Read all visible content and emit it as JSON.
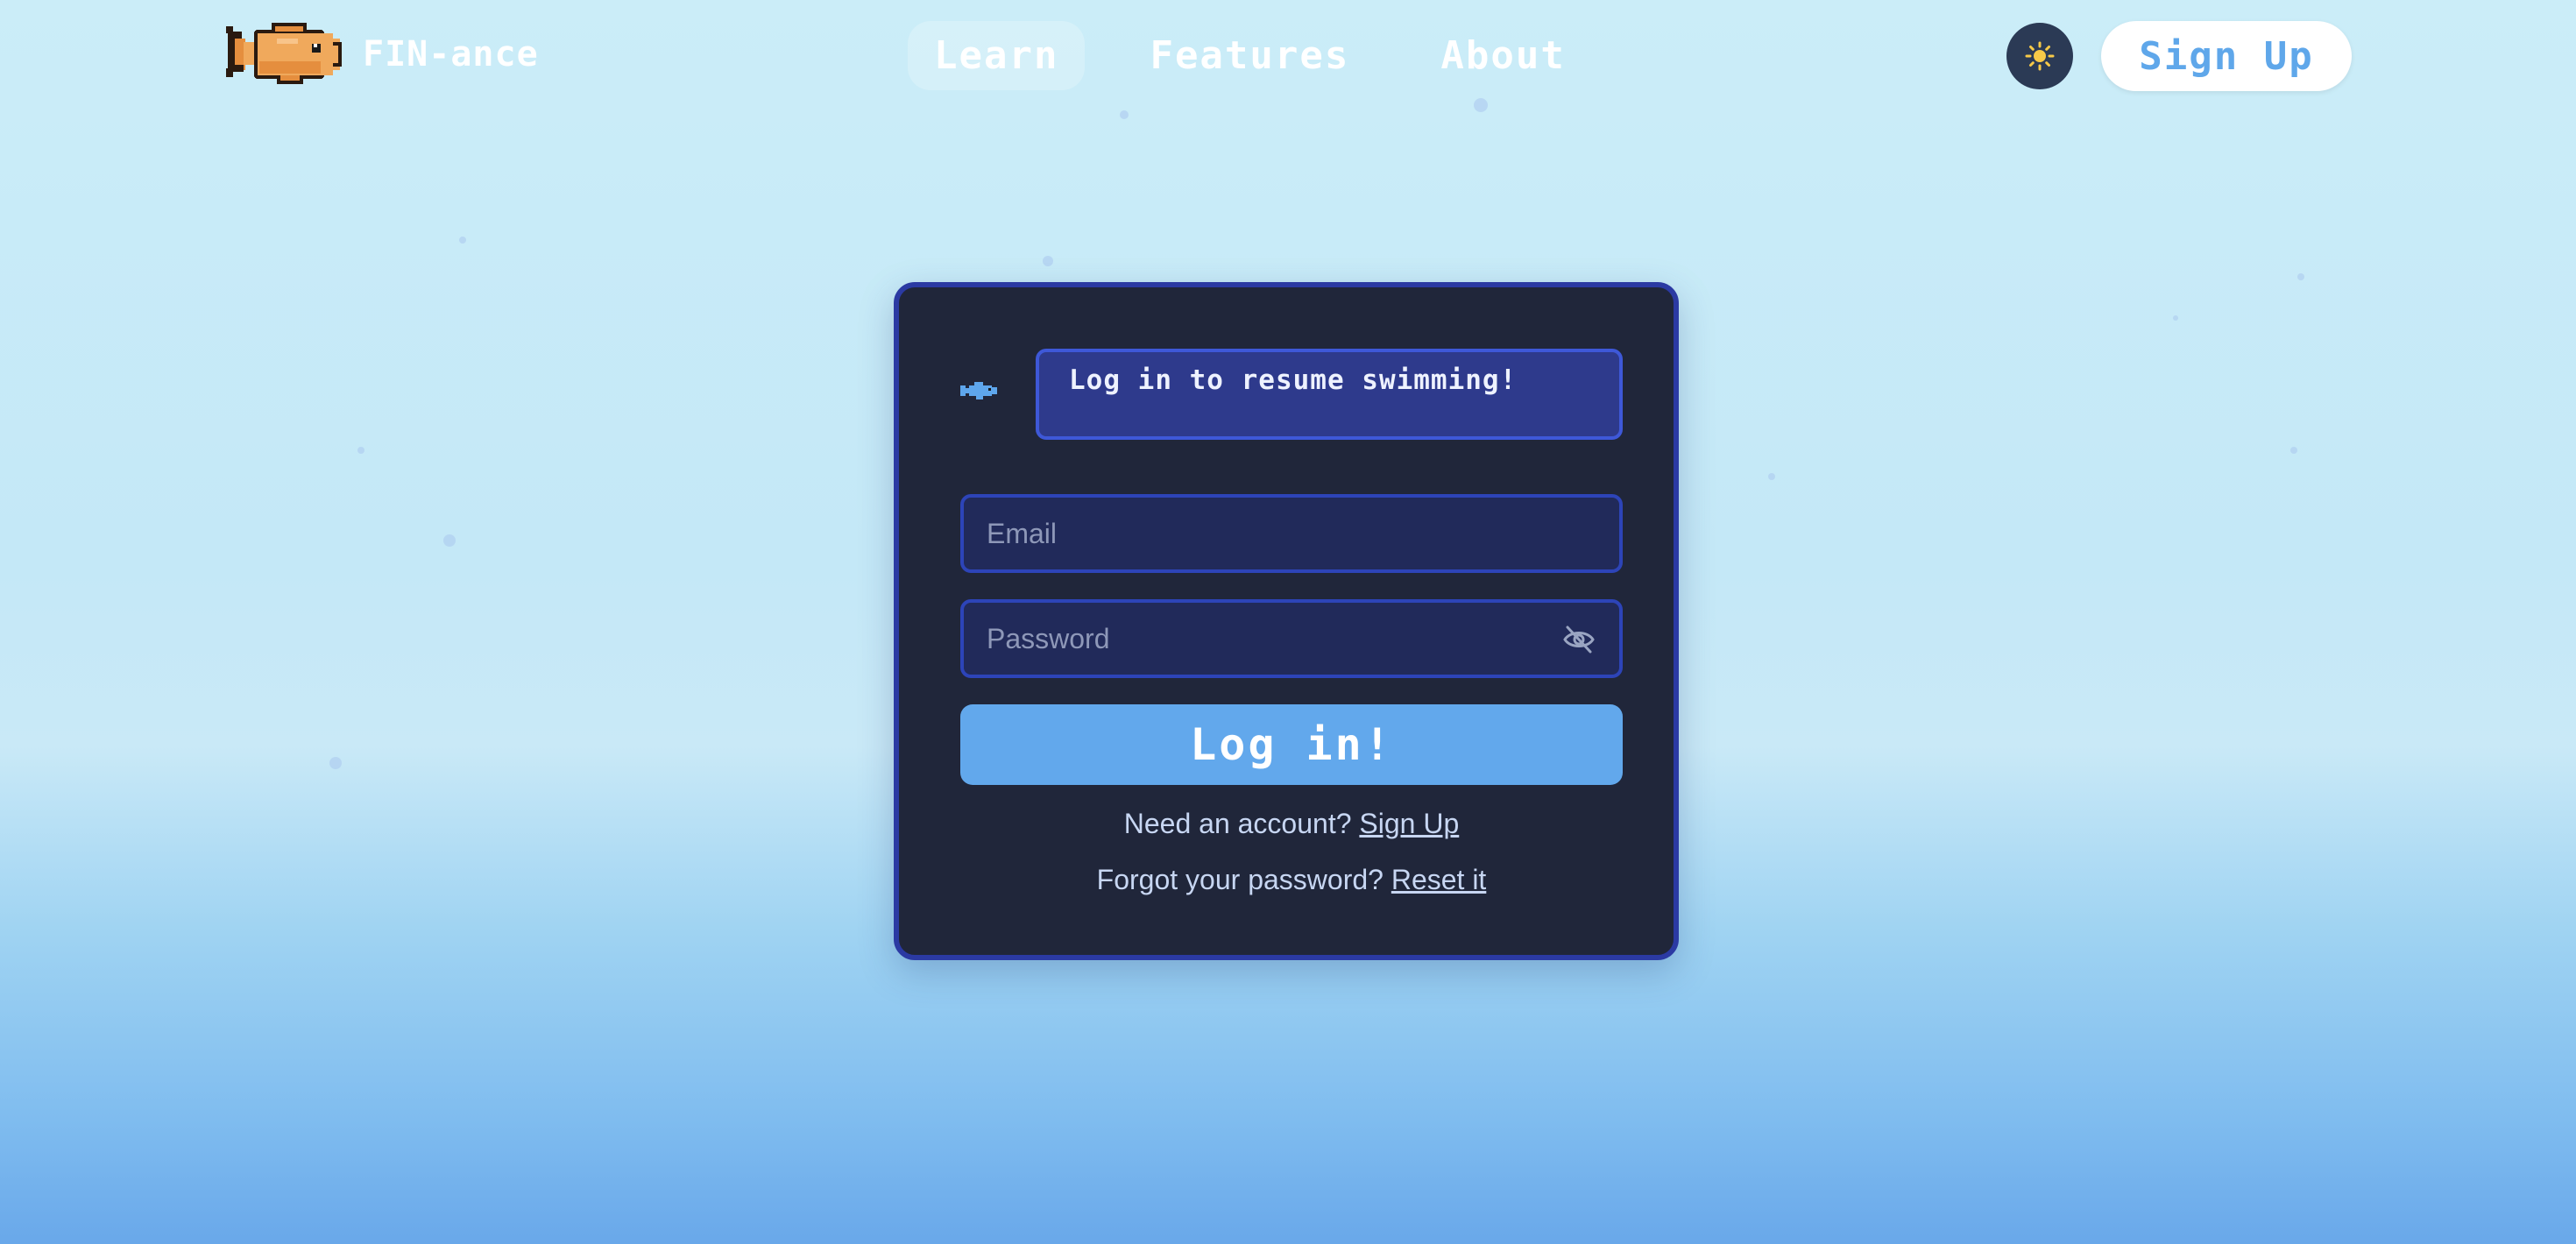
{
  "brand": {
    "name": "FIN-ance",
    "logo_icon": "goldfish-icon"
  },
  "nav": {
    "items": [
      {
        "label": "Learn",
        "active": true
      },
      {
        "label": "Features",
        "active": false
      },
      {
        "label": "About",
        "active": false
      }
    ]
  },
  "header": {
    "theme_toggle_icon": "sun-icon",
    "signup_label": "Sign Up"
  },
  "login": {
    "speech": "Log in to resume swimming!",
    "email_placeholder": "Email",
    "password_placeholder": "Password",
    "password_toggle_icon": "eye-slash-icon",
    "submit_label": "Log in!",
    "need_account_text": "Need an account?",
    "need_account_link": "Sign Up",
    "forgot_text": "Forgot your password?",
    "forgot_link": "Reset it"
  },
  "colors": {
    "card_bg": "#20263a",
    "card_border": "#2b3aa3",
    "accent": "#62a8ec",
    "fish": "#f0a95c"
  }
}
